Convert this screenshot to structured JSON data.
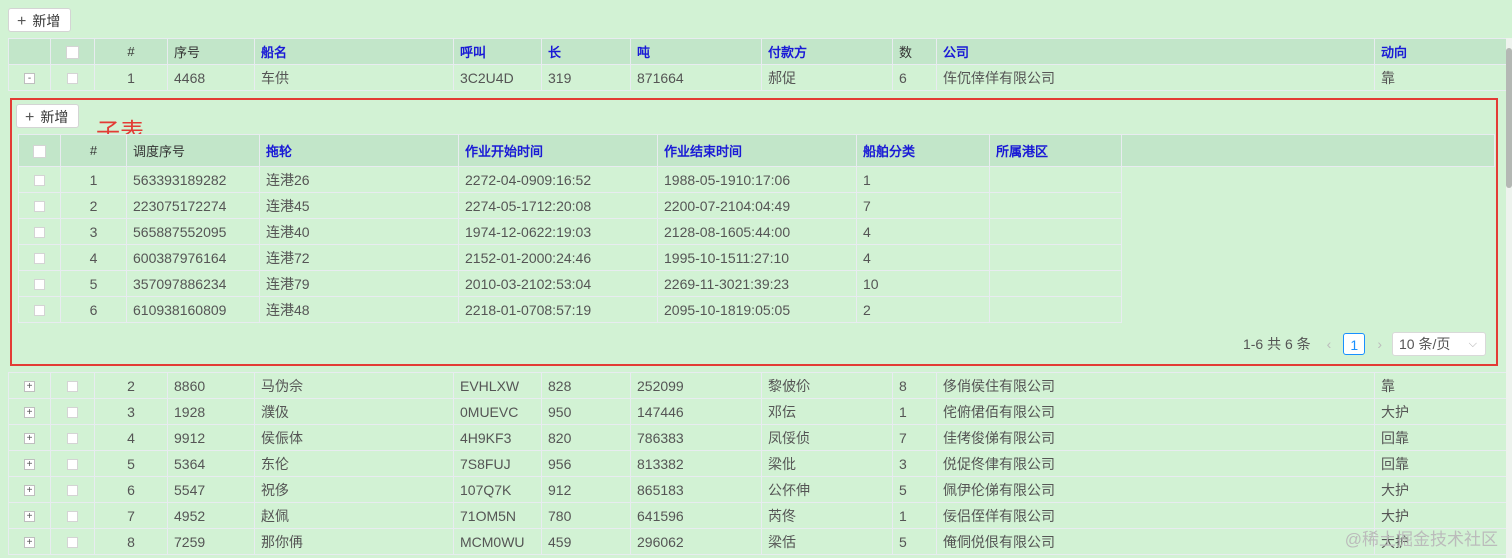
{
  "toolbar": {
    "add_label": "新增"
  },
  "main": {
    "columns": [
      "#",
      "序号",
      "船名",
      "呼叫",
      "长",
      "吨",
      "付款方",
      "数",
      "公司",
      "动向"
    ],
    "expanded_row": {
      "expand": "-",
      "num": "1",
      "seq": "4468",
      "name": "车供",
      "call": "3C2U4D",
      "len": "319",
      "ton": "871664",
      "payer": "郝促",
      "count": "6",
      "company": "伡伔倖佯有限公司",
      "dir": "靠"
    },
    "rows": [
      {
        "num": "2",
        "seq": "8860",
        "name": "马伪佘",
        "call": "EVHLXW",
        "len": "828",
        "ton": "252099",
        "payer": "黎佊伱",
        "count": "8",
        "company": "侈俏侯住有限公司",
        "dir": "靠"
      },
      {
        "num": "3",
        "seq": "1928",
        "name": "濮伋",
        "call": "0MUEVC",
        "len": "950",
        "ton": "147446",
        "payer": "邓伝",
        "count": "1",
        "company": "侘俯侰佰有限公司",
        "dir": "大护"
      },
      {
        "num": "4",
        "seq": "9912",
        "name": "侯侲体",
        "call": "4H9KF3",
        "len": "820",
        "ton": "786383",
        "payer": "凤俀侦",
        "count": "7",
        "company": "佳侤俊俤有限公司",
        "dir": "回靠"
      },
      {
        "num": "5",
        "seq": "5364",
        "name": "东伦",
        "call": "7S8FUJ",
        "len": "956",
        "ton": "813382",
        "payer": "梁仳",
        "count": "3",
        "company": "侻促佟侓有限公司",
        "dir": "回靠"
      },
      {
        "num": "6",
        "seq": "5547",
        "name": "祝侈",
        "call": "107Q7K",
        "len": "912",
        "ton": "865183",
        "payer": "公伓伸",
        "count": "5",
        "company": "佩伊伦俤有限公司",
        "dir": "大护"
      },
      {
        "num": "7",
        "seq": "4952",
        "name": "赵佩",
        "call": "71OM5N",
        "len": "780",
        "ton": "641596",
        "payer": "芮佟",
        "count": "1",
        "company": "佞侣侄佯有限公司",
        "dir": "大护"
      },
      {
        "num": "8",
        "seq": "7259",
        "name": "那你侢",
        "call": "MCM0WU",
        "len": "459",
        "ton": "296062",
        "payer": "梁佸",
        "count": "5",
        "company": "俺侗侻佷有限公司",
        "dir": "大护"
      }
    ],
    "expand_plus": "+"
  },
  "subtable": {
    "label": "子表",
    "add_label": "新增",
    "columns": [
      "#",
      "调度序号",
      "拖轮",
      "作业开始时间",
      "作业结束时间",
      "船舶分类",
      "所属港区"
    ],
    "rows": [
      {
        "num": "1",
        "seq": "563393189282",
        "tug": "连港26",
        "start": "2272-04-0909:16:52",
        "end": "1988-05-1910:17:06",
        "cat": "1",
        "port": ""
      },
      {
        "num": "2",
        "seq": "223075172274",
        "tug": "连港45",
        "start": "2274-05-1712:20:08",
        "end": "2200-07-2104:04:49",
        "cat": "7",
        "port": ""
      },
      {
        "num": "3",
        "seq": "565887552095",
        "tug": "连港40",
        "start": "1974-12-0622:19:03",
        "end": "2128-08-1605:44:00",
        "cat": "4",
        "port": ""
      },
      {
        "num": "4",
        "seq": "600387976164",
        "tug": "连港72",
        "start": "2152-01-2000:24:46",
        "end": "1995-10-1511:27:10",
        "cat": "4",
        "port": ""
      },
      {
        "num": "5",
        "seq": "357097886234",
        "tug": "连港79",
        "start": "2010-03-2102:53:04",
        "end": "2269-11-3021:39:23",
        "cat": "10",
        "port": ""
      },
      {
        "num": "6",
        "seq": "610938160809",
        "tug": "连港48",
        "start": "2218-01-0708:57:19",
        "end": "2095-10-1819:05:05",
        "cat": "2",
        "port": ""
      }
    ],
    "pagination": {
      "total": "1-6 共 6 条",
      "page": "1",
      "page_size": "10 条/页",
      "prev": "‹",
      "next": "›"
    }
  },
  "watermark": "@稀土掘金技术社区"
}
